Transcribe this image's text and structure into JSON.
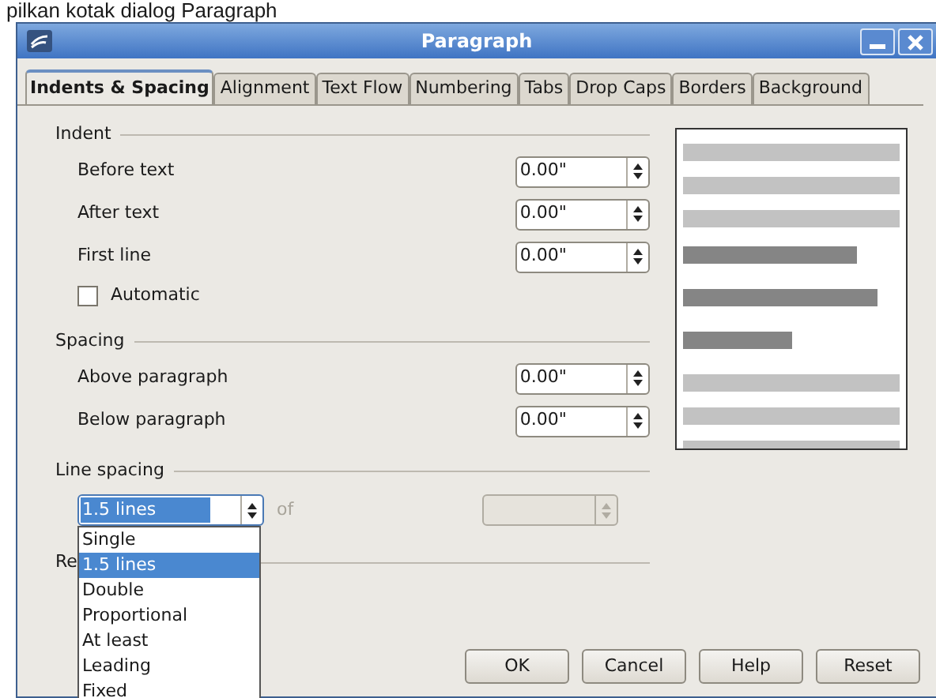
{
  "caption": "pilkan kotak dialog Paragraph",
  "window": {
    "title": "Paragraph"
  },
  "tabs": [
    {
      "label": "Indents & Spacing",
      "selected": true
    },
    {
      "label": "Alignment",
      "selected": false
    },
    {
      "label": "Text Flow",
      "selected": false
    },
    {
      "label": "Numbering",
      "selected": false
    },
    {
      "label": "Tabs",
      "selected": false
    },
    {
      "label": "Drop Caps",
      "selected": false
    },
    {
      "label": "Borders",
      "selected": false
    },
    {
      "label": "Background",
      "selected": false
    }
  ],
  "sections": [
    {
      "title": "Indent",
      "rows": [
        {
          "kind": "spin",
          "label": "Before text",
          "value": "0.00\""
        },
        {
          "kind": "spin",
          "label": "After text",
          "value": "0.00\""
        },
        {
          "kind": "spin",
          "label": "First line",
          "value": "0.00\""
        },
        {
          "kind": "checkbox",
          "label": "Automatic",
          "checked": false
        }
      ]
    },
    {
      "title": "Spacing",
      "rows": [
        {
          "kind": "spin",
          "label": "Above paragraph",
          "value": "0.00\""
        },
        {
          "kind": "spin",
          "label": "Below paragraph",
          "value": "0.00\""
        }
      ]
    },
    {
      "title": "Line spacing",
      "rows": [
        {
          "kind": "combo",
          "value": "1.5 lines",
          "expanded": true,
          "of_label": "of",
          "of_disabled": true,
          "options": [
            {
              "label": "Single",
              "selected": false
            },
            {
              "label": "1.5 lines",
              "selected": true
            },
            {
              "label": "Double",
              "selected": false
            },
            {
              "label": "Proportional",
              "selected": false
            },
            {
              "label": "At least",
              "selected": false
            },
            {
              "label": "Leading",
              "selected": false
            },
            {
              "label": "Fixed",
              "selected": false
            }
          ]
        }
      ]
    },
    {
      "title": "Re"
    }
  ],
  "buttons": [
    "OK",
    "Cancel",
    "Help",
    "Reset"
  ]
}
